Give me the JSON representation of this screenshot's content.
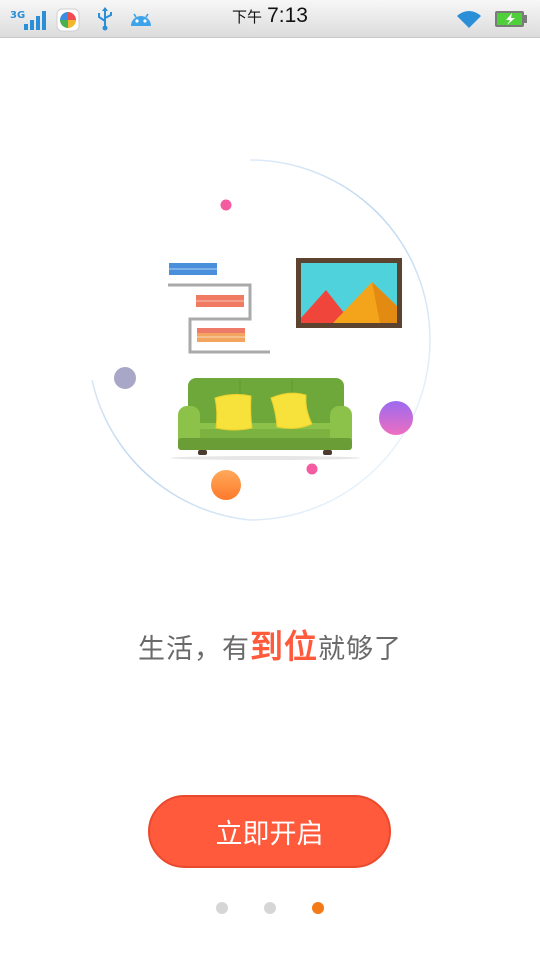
{
  "status_bar": {
    "network_type": "3G",
    "time_prefix": "下午",
    "time": "7:13",
    "icons": [
      "signal-icon",
      "app-notification-icon",
      "usb-icon",
      "android-debug-icon",
      "wifi-icon",
      "battery-charging-icon"
    ]
  },
  "slogan": {
    "part1": "生活，有",
    "highlight": "到位",
    "part2": "就够了"
  },
  "start_button": {
    "label": "立即开启"
  },
  "pager": {
    "total": 3,
    "active": 3
  },
  "colors": {
    "accent": "#fe5a3b",
    "active_dot": "#f37a16",
    "inactive_dot": "#d6d6d6",
    "sofa": "#6ea83a",
    "pillow": "#f6e23a"
  }
}
